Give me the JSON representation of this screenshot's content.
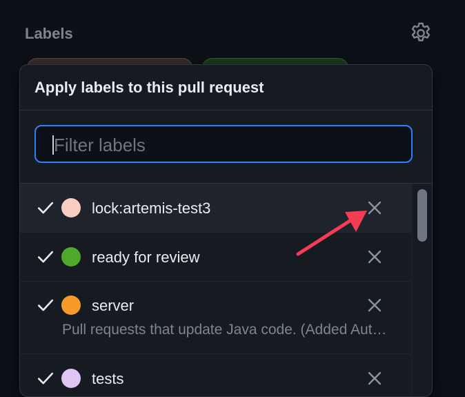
{
  "sidebar": {
    "heading": "Labels",
    "settings_icon": "gear-icon"
  },
  "popover": {
    "title": "Apply labels to this pull request",
    "filter": {
      "placeholder": "Filter labels",
      "value": ""
    },
    "items": [
      {
        "name": "lock:artemis-test3",
        "color": "#f8cec0",
        "checked": true,
        "description": ""
      },
      {
        "name": "ready for review",
        "color": "#4fa82a",
        "checked": true,
        "description": ""
      },
      {
        "name": "server",
        "color": "#f79a2a",
        "checked": true,
        "description": "Pull requests that update Java code. (Added Automatically!)"
      },
      {
        "name": "tests",
        "color": "#e0c4f4",
        "checked": true,
        "description": ""
      }
    ]
  },
  "colors": {
    "background": "#0d1117",
    "popover": "#161b22",
    "accent_border": "#2f81f7",
    "annotation_arrow": "#f43c52"
  }
}
